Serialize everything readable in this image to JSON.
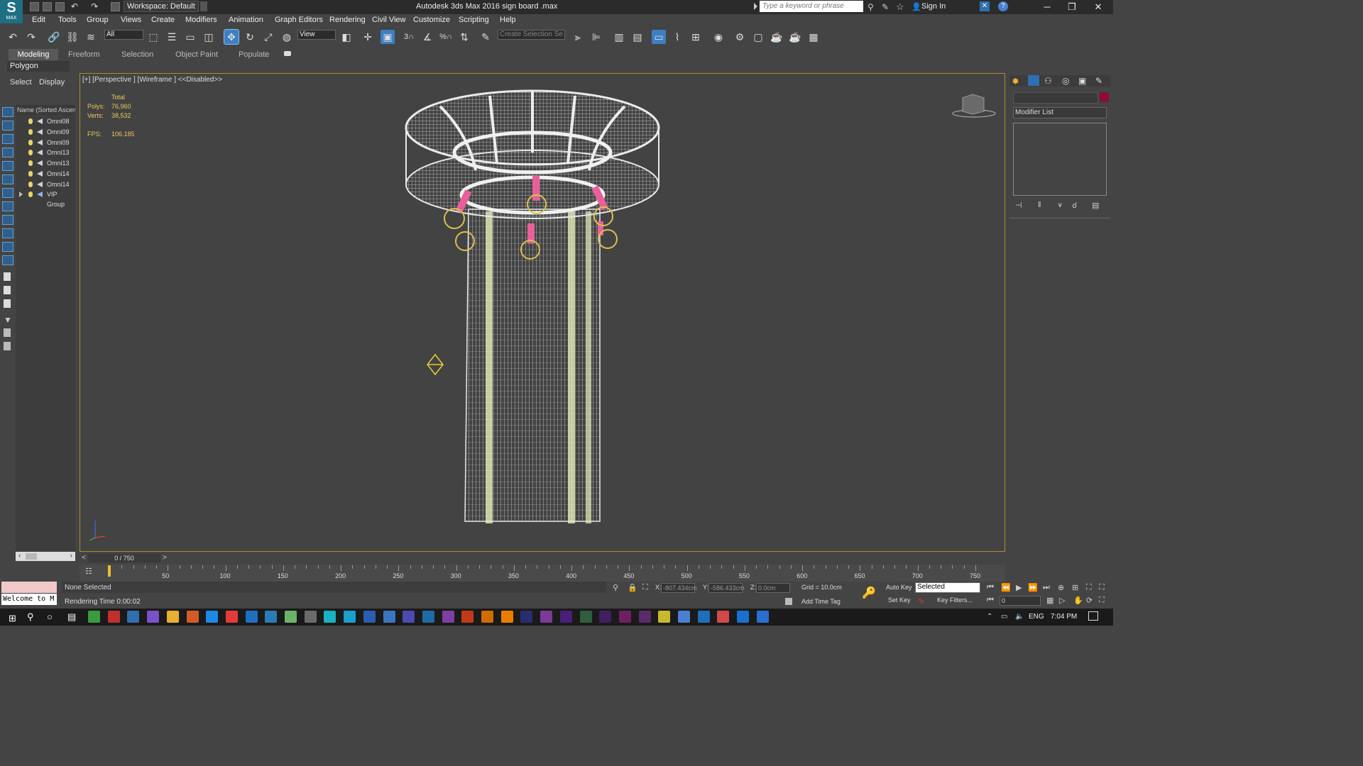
{
  "app": {
    "logo_text": "MAX",
    "title": "Autodesk 3ds Max 2016   sign board .max",
    "workspace": "Workspace: Default",
    "search_placeholder": "Type a keyword or phrase",
    "sign_in": "Sign In"
  },
  "menu": [
    "Edit",
    "Tools",
    "Group",
    "Views",
    "Create",
    "Modifiers",
    "Animation",
    "Graph Editors",
    "Rendering",
    "Civil View",
    "Customize",
    "Scripting",
    "Help"
  ],
  "toolbar": {
    "filter_value": "All",
    "refcoord_value": "View",
    "selection_set_placeholder": "Create Selection Se",
    "snap_3": "3",
    "snap_angle": "%"
  },
  "ribbon": {
    "tabs": [
      "Modeling",
      "Freeform",
      "Selection",
      "Object Paint",
      "Populate"
    ],
    "subpanel": "Polygon Modeling"
  },
  "explorer": {
    "tabs": [
      "Select",
      "Display"
    ],
    "column_header": "Name (Sorted Ascen",
    "rows": [
      "Omni08",
      "Omni09",
      "Omni09",
      "Omni13",
      "Omni13",
      "Omni14",
      "Omni14",
      "VIP Group"
    ]
  },
  "viewport": {
    "label": "[+] [Perspective ] [Wireframe ]  <<Disabled>>",
    "stats_total_label": "Total",
    "polys_label": "Polys:",
    "polys_value": "76,960",
    "verts_label": "Verts:",
    "verts_value": "38,532",
    "fps_label": "FPS:",
    "fps_value": "106.185"
  },
  "command_panel": {
    "modifier_list": "Modifier List"
  },
  "timeline": {
    "slider_text": "0 / 750",
    "prev": "<",
    "next": ">",
    "ticks": [
      "50",
      "100",
      "150",
      "200",
      "250",
      "300",
      "350",
      "400",
      "450",
      "500",
      "550",
      "600",
      "650",
      "700",
      "750"
    ]
  },
  "status": {
    "maxscript_text": "Welcome to M",
    "selection": "None Selected",
    "render_time": "Rendering Time  0:00:02",
    "x_label": "X:",
    "x_value": "-807.434cm",
    "y_label": "Y:",
    "y_value": "-586.433cm",
    "z_label": "Z:",
    "z_value": "0.0cm",
    "grid": "Grid = 10.0cm",
    "add_time_tag": "Add Time Tag",
    "auto_key": "Auto Key",
    "auto_key_mode": "Selected",
    "set_key": "Set Key",
    "key_filters": "Key Filters...",
    "frame_value": "0"
  },
  "taskbar": {
    "lang": "ENG",
    "time": "7:04 PM",
    "app_colors": [
      "#3c9a3c",
      "#c03030",
      "#2f6fb0",
      "#7a52c8",
      "#e8b030",
      "#d35b2a",
      "#1e88e5",
      "#e23b3b",
      "#1f6fbf",
      "#2b7bb9",
      "#6bb36b",
      "#6a6a6a",
      "#19b2c0",
      "#1a9ecc",
      "#2a5db0",
      "#3a76c0",
      "#4a4ab0",
      "#1f6aa5",
      "#7d3fa0",
      "#c23a1a",
      "#d26b00",
      "#e87d00",
      "#2b2b6f",
      "#7b3a9a",
      "#4a1f7a",
      "#2f5f3f",
      "#3f1f5f",
      "#6f1f5f",
      "#5a2a6a",
      "#c8b830",
      "#4a7fd0",
      "#1e6fb8",
      "#d04a4a",
      "#1b6fd0",
      "#2a6fd0"
    ],
    "colors": {
      "accent": "#1d6f83",
      "viewport_border": "#b08a2a",
      "stat_text": "#e8c85a",
      "object_color": "#8a0f32"
    }
  }
}
